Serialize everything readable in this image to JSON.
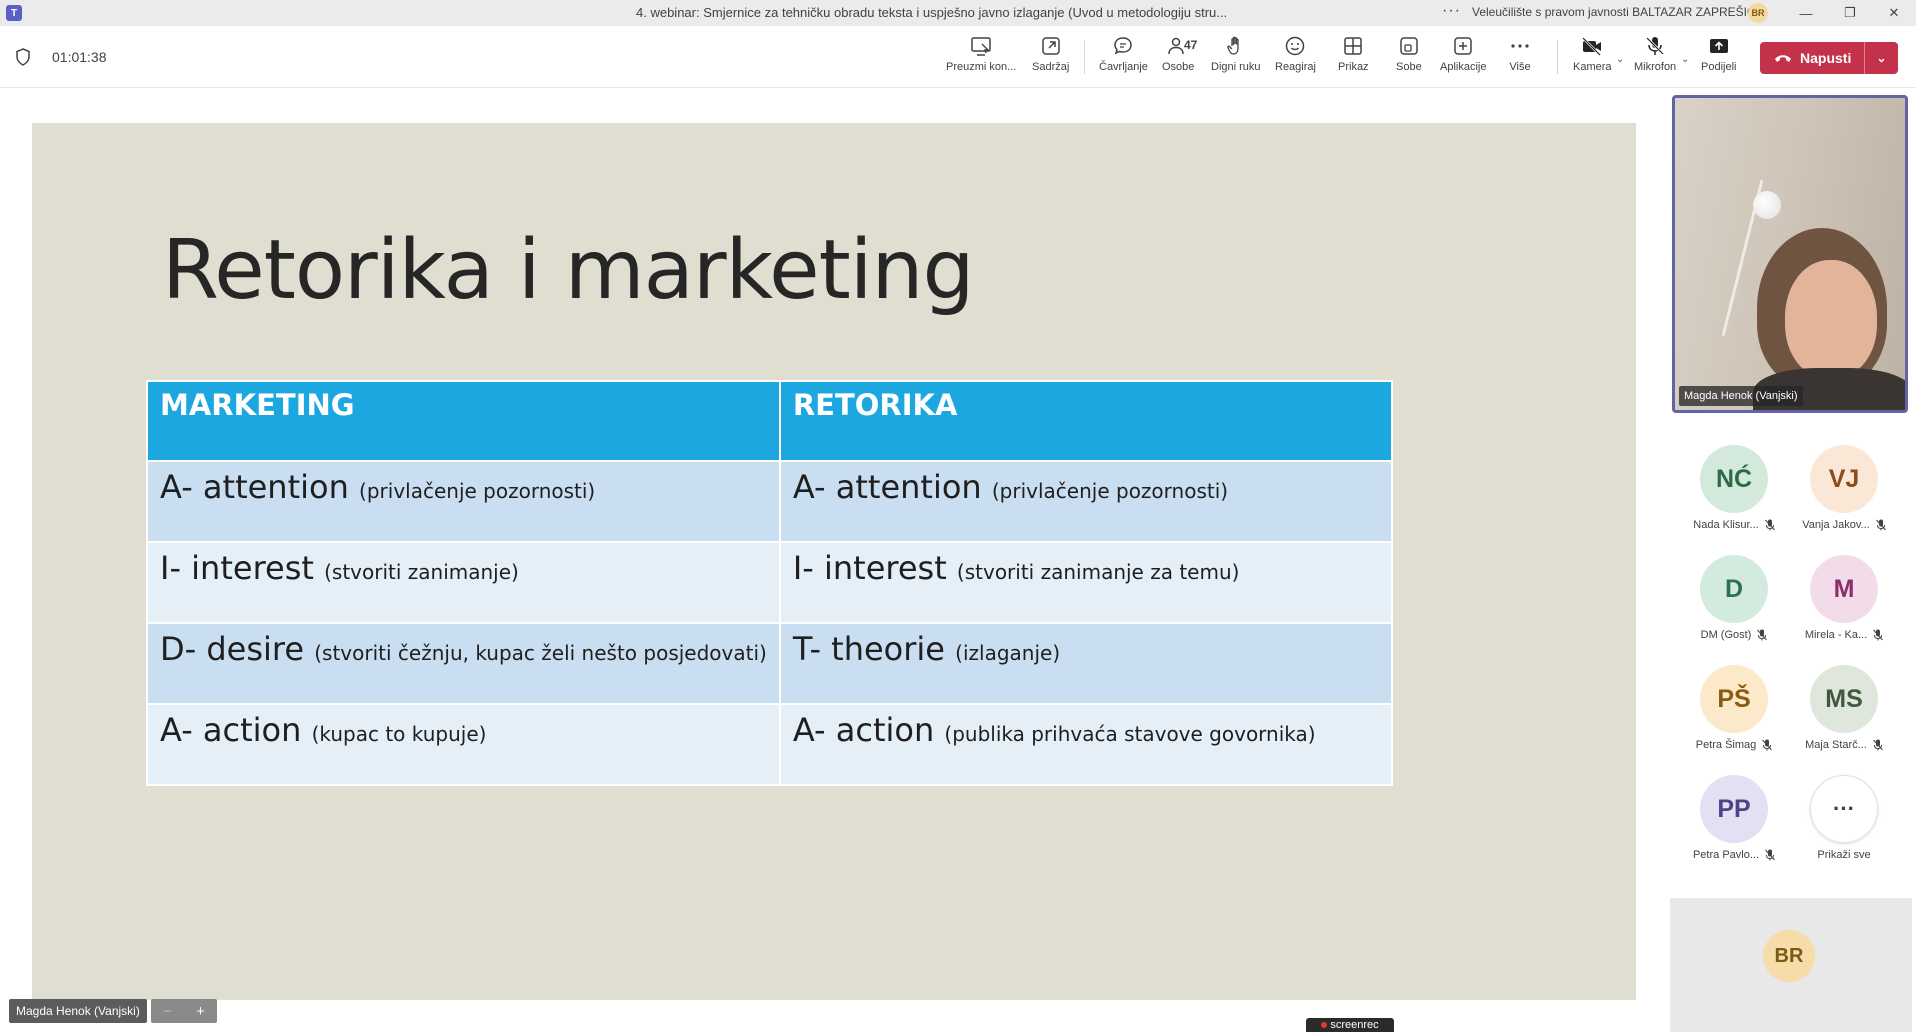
{
  "window": {
    "title": "4. webinar: Smjernice za tehničku obradu teksta i uspješno javno izlaganje (Uvod u metodologiju stru...",
    "more": "···",
    "org": "Veleučilište s pravom javnosti BALTAZAR ZAPREŠIĆ",
    "org_initials": "BR",
    "controls": {
      "minimize": "—",
      "maximize": "❐",
      "close": "✕"
    }
  },
  "toolbar": {
    "timer": "01:01:38",
    "items": [
      {
        "id": "take-control",
        "label": "Preuzmi kon...",
        "icon": "take-control-icon"
      },
      {
        "id": "content",
        "label": "Sadržaj",
        "icon": "share-out-icon"
      },
      {
        "id": "chat",
        "label": "Čavrljanje",
        "icon": "chat-icon"
      },
      {
        "id": "people",
        "label": "Osobe",
        "icon": "people-icon",
        "count": "47"
      },
      {
        "id": "raise-hand",
        "label": "Digni ruku",
        "icon": "hand-icon"
      },
      {
        "id": "react",
        "label": "Reagiraj",
        "icon": "smile-icon"
      },
      {
        "id": "view",
        "label": "Prikaz",
        "icon": "grid-icon"
      },
      {
        "id": "rooms",
        "label": "Sobe",
        "icon": "rooms-icon"
      },
      {
        "id": "apps",
        "label": "Aplikacije",
        "icon": "plus-icon"
      },
      {
        "id": "more",
        "label": "Više",
        "icon": "ellipsis-icon"
      },
      {
        "id": "camera",
        "label": "Kamera",
        "icon": "camera-off-icon"
      },
      {
        "id": "mic",
        "label": "Mikrofon",
        "icon": "mic-off-icon"
      },
      {
        "id": "share",
        "label": "Podijeli",
        "icon": "share-icon"
      }
    ],
    "leave_label": "Napusti"
  },
  "slide": {
    "title": "Retorika i marketing",
    "headers": [
      "MARKETING",
      "RETORIKA"
    ],
    "rows": [
      {
        "left_term": "A- attention ",
        "left_note": "(privlačenje pozornosti)",
        "right_term": "A- attention  ",
        "right_note": "(privlačenje pozornosti)"
      },
      {
        "left_term": "I- interest ",
        "left_note": "(stvoriti zanimanje)",
        "right_term": "I- interest ",
        "right_note": "(stvoriti zanimanje za temu)"
      },
      {
        "left_term": "D- desire ",
        "left_note": "(stvoriti čežnju, kupac želi nešto posjedovati)",
        "right_term": "T- theorie ",
        "right_note": "(izlaganje)"
      },
      {
        "left_term": "A- action ",
        "left_note": "(kupac to kupuje)",
        "right_term": "A- action ",
        "right_note": "(publika prihvaća stavove govornika)"
      }
    ]
  },
  "stage": {
    "presenter_tag": "Magda Henok (Vanjski)",
    "zoom_minus": "−",
    "zoom_plus": "+",
    "watermark": "screenrec"
  },
  "panel": {
    "video_name": "Magda Henok (Vanjski)",
    "participants": [
      {
        "initials": "NĆ",
        "name": "Nada Klisur...",
        "bg": "#d3e9dc",
        "fg": "#2d6b44"
      },
      {
        "initials": "VJ",
        "name": "Vanja Jakov...",
        "bg": "#fbe7d5",
        "fg": "#8a4d1a"
      },
      {
        "initials": "D",
        "name": "DM (Gost)",
        "bg": "#d3ebdf",
        "fg": "#2e7152"
      },
      {
        "initials": "M",
        "name": "Mirela - Ka...",
        "bg": "#f2dcea",
        "fg": "#8a2f6b"
      },
      {
        "initials": "PŠ",
        "name": "Petra Šimag",
        "bg": "#fbe9c9",
        "fg": "#8a5a10"
      },
      {
        "initials": "MS",
        "name": "Maja Starč...",
        "bg": "#dfe6dc",
        "fg": "#3f5a3a"
      },
      {
        "initials": "PP",
        "name": "Petra Pavlo...",
        "bg": "#e4dff2",
        "fg": "#4f4287"
      },
      {
        "initials": "···",
        "name": "Prikaži sve",
        "bg": "#ffffff",
        "fg": "#424242"
      }
    ],
    "self_initials": "BR"
  }
}
